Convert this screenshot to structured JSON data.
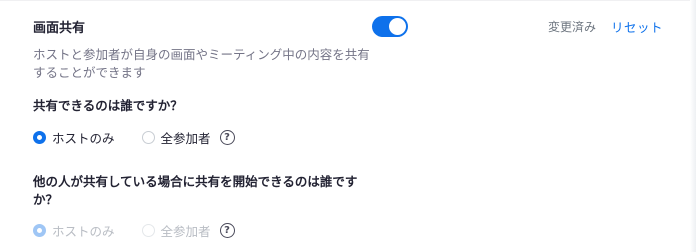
{
  "setting": {
    "title": "画面共有",
    "enabled": true,
    "status": "変更済み",
    "reset_label": "リセット",
    "description": "ホストと参加者が自身の画面やミーティング中の内容を共有することができます"
  },
  "question_who_can_share": {
    "label": "共有できるのは誰ですか？",
    "options": [
      {
        "label": "ホストのみ",
        "selected": true
      },
      {
        "label": "全参加者",
        "selected": false
      }
    ],
    "help_icon": "?"
  },
  "question_who_can_start_share": {
    "label": "他の人が共有している場合に共有を開始できるのは誰ですか？",
    "disabled": true,
    "options": [
      {
        "label": "ホストのみ",
        "selected": true
      },
      {
        "label": "全参加者",
        "selected": false
      }
    ],
    "help_icon": "?"
  },
  "colors": {
    "accent": "#0e71eb",
    "text": "#232333",
    "muted": "#747487",
    "disabled_text": "#b9bdc4"
  }
}
